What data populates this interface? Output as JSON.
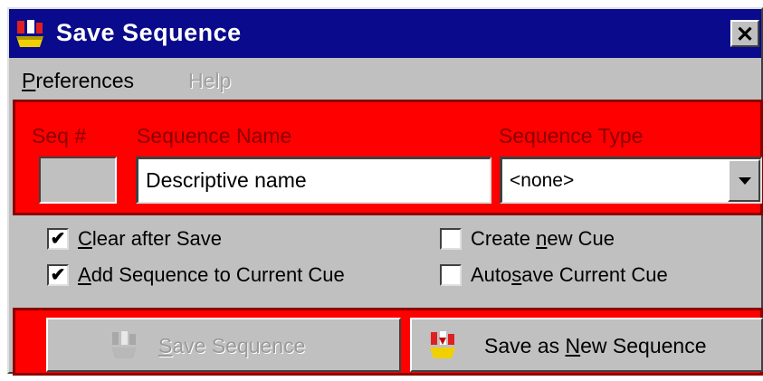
{
  "window": {
    "title": "Save Sequence",
    "close_glyph": "✕",
    "icon": "sequence-app-icon"
  },
  "menu": {
    "items": [
      {
        "label": "Preferences",
        "enabled": true
      },
      {
        "label": "Help",
        "enabled": false
      }
    ]
  },
  "sequence": {
    "seq_num_label": "Seq #",
    "seq_num_value": "",
    "name_label": "Sequence Name",
    "name_value": "Descriptive name",
    "type_label": "Sequence Type",
    "type_value": "<none>"
  },
  "options": [
    {
      "label": "Clear after Save",
      "checked": true
    },
    {
      "label": "Add Sequence to Current Cue",
      "checked": true
    },
    {
      "label": "Create new Cue",
      "checked": false
    },
    {
      "label": "Autosave Current Cue",
      "checked": false
    }
  ],
  "buttons": {
    "save_label": "Save Sequence",
    "save_enabled": false,
    "save_new_label": "Save as New Sequence",
    "save_new_enabled": true
  },
  "colors": {
    "title_bar": "#0a0a8c",
    "highlight_panel": "#ff0000",
    "panel_label": "#8a0000",
    "dialog_face": "#c0c0c0"
  }
}
